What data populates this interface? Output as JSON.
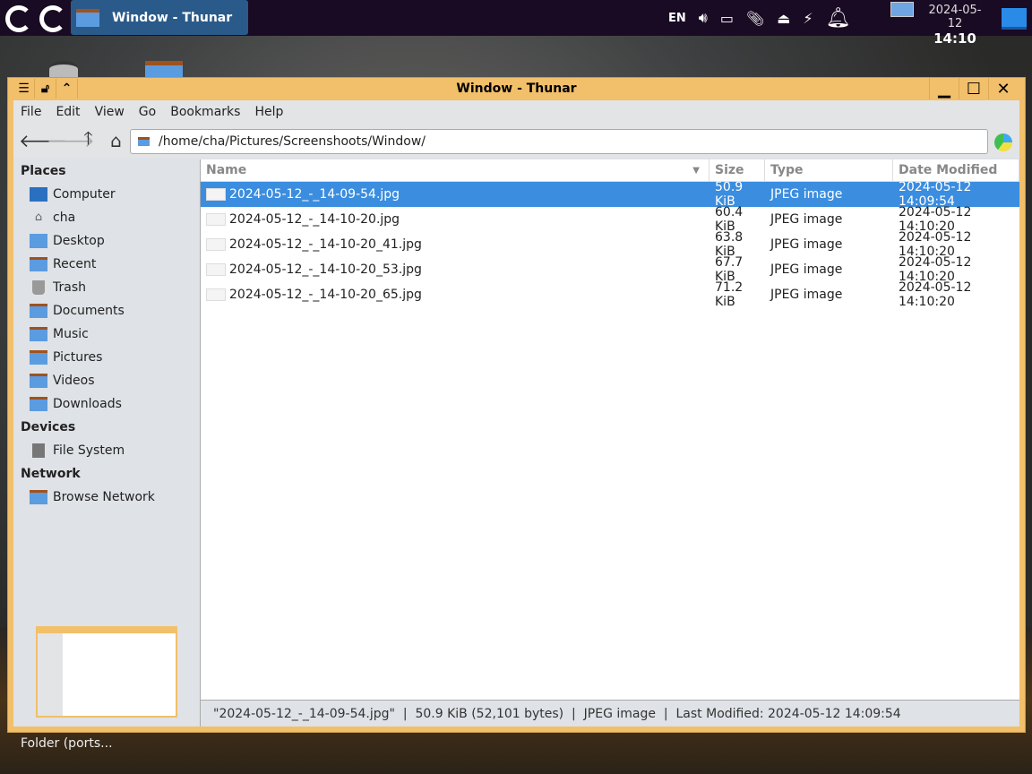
{
  "panel": {
    "task_title": "Window - Thunar",
    "lang": "EN",
    "date": "2024-05-12",
    "time": "14:10"
  },
  "window": {
    "title": "Window - Thunar"
  },
  "menu": [
    "File",
    "Edit",
    "View",
    "Go",
    "Bookmarks",
    "Help"
  ],
  "path": "/home/cha/Pictures/Screenshoots/Window/",
  "sidebar": {
    "places_label": "Places",
    "places": [
      "Computer",
      "cha",
      "Desktop",
      "Recent",
      "Trash",
      "Documents",
      "Music",
      "Pictures",
      "Videos",
      "Downloads"
    ],
    "devices_label": "Devices",
    "devices": [
      "File System"
    ],
    "network_label": "Network",
    "network": [
      "Browse Network"
    ]
  },
  "columns": [
    "Name",
    "Size",
    "Type",
    "Date Modified"
  ],
  "files": [
    {
      "name": "2024-05-12_-_14-09-54.jpg",
      "size": "50.9 KiB",
      "type": "JPEG image",
      "date": "2024-05-12 14:09:54"
    },
    {
      "name": "2024-05-12_-_14-10-20.jpg",
      "size": "60.4 KiB",
      "type": "JPEG image",
      "date": "2024-05-12 14:10:20"
    },
    {
      "name": "2024-05-12_-_14-10-20_41.jpg",
      "size": "63.8 KiB",
      "type": "JPEG image",
      "date": "2024-05-12 14:10:20"
    },
    {
      "name": "2024-05-12_-_14-10-20_53.jpg",
      "size": "67.7 KiB",
      "type": "JPEG image",
      "date": "2024-05-12 14:10:20"
    },
    {
      "name": "2024-05-12_-_14-10-20_65.jpg",
      "size": "71.2 KiB",
      "type": "JPEG image",
      "date": "2024-05-12 14:10:20"
    }
  ],
  "status": "\"2024-05-12_-_14-09-54.jpg\"  |  50.9 KiB (52,101 bytes)  |  JPEG image  |  Last Modified: 2024-05-12 14:09:54",
  "desktop_label": "Folder (ports..."
}
